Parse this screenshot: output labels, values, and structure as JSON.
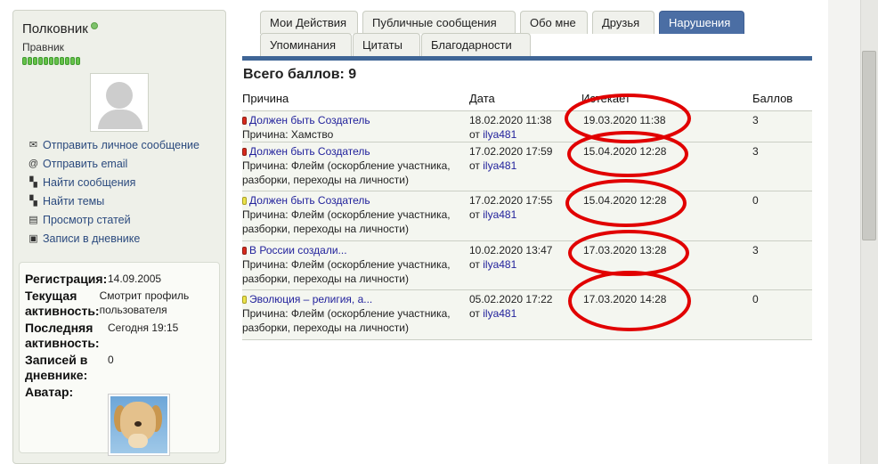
{
  "profile": {
    "username": "Полковник",
    "user_title": "Правник",
    "reputation_level": 11,
    "links": [
      {
        "label": "Отправить личное сообщение",
        "icon": "envelope-icon"
      },
      {
        "label": "Отправить email",
        "icon": "at-sign-icon"
      },
      {
        "label": "Найти сообщения",
        "icon": "posts-icon"
      },
      {
        "label": "Найти темы",
        "icon": "threads-icon"
      },
      {
        "label": "Просмотр статей",
        "icon": "articles-icon"
      },
      {
        "label": "Записи в дневнике",
        "icon": "diary-icon"
      }
    ],
    "info": {
      "registration_label": "Регистрация:",
      "registration_value": "14.09.2005",
      "activity_label": "Текущая активность:",
      "activity_value": "Смотрит профиль пользователя",
      "last_activity_label": "Последняя активность:",
      "last_activity_value": "Сегодня 19:15",
      "diary_label": "Записей в дневнике:",
      "diary_value": "0",
      "avatar_label": "Аватар:"
    }
  },
  "tabs": [
    {
      "label": "Мои Действия",
      "active": false
    },
    {
      "label": "Публичные сообщения",
      "active": false
    },
    {
      "label": "Обо мне",
      "active": false
    },
    {
      "label": "Друзья",
      "active": false
    },
    {
      "label": "Нарушения",
      "active": true
    },
    {
      "label": "Упоминания",
      "active": false
    },
    {
      "label": "Цитаты",
      "active": false
    },
    {
      "label": "Благодарности",
      "active": false
    }
  ],
  "infractions": {
    "total_label": "Всего баллов: 9",
    "columns": [
      "Причина",
      "Дата",
      "Истекает",
      "Баллов"
    ],
    "by_prefix": "от",
    "rows": [
      {
        "flag": "red",
        "title": "Должен быть Создатель",
        "reason": "Причина: Хамство",
        "date": "18.02.2020 11:38",
        "by": "ilya481",
        "expires": "19.03.2020 11:38",
        "points": "3"
      },
      {
        "flag": "red",
        "title": "Должен быть Создатель",
        "reason": "Причина: Флейм (оскорбление участника, разборки, переходы на личности)",
        "date": "17.02.2020 17:59",
        "by": "ilya481",
        "expires": "15.04.2020 12:28",
        "points": "3"
      },
      {
        "flag": "yellow",
        "title": "Должен быть Создатель",
        "reason": "Причина: Флейм (оскорбление участника, разборки, переходы на личности)",
        "date": "17.02.2020 17:55",
        "by": "ilya481",
        "expires": "15.04.2020 12:28",
        "points": "0"
      },
      {
        "flag": "red",
        "title": "В России создали...",
        "reason": "Причина: Флейм (оскорбление участника, разборки, переходы на личности)",
        "date": "10.02.2020 13:47",
        "by": "ilya481",
        "expires": "17.03.2020 13:28",
        "points": "3"
      },
      {
        "flag": "yellow",
        "title": "Эволюция – религия, а...",
        "reason": "Причина: Флейм (оскорбление участника, разборки, переходы на личности)",
        "date": "05.02.2020 17:22",
        "by": "ilya481",
        "expires": "17.03.2020 14:28",
        "points": "0"
      }
    ]
  },
  "colors": {
    "tab_active": "#4b6ea4",
    "tab_bar": "#3f6596",
    "annotation": "#e10000",
    "flag_red": "#d82a1c",
    "flag_yellow": "#ece44c",
    "reputation": "#66c24a"
  }
}
